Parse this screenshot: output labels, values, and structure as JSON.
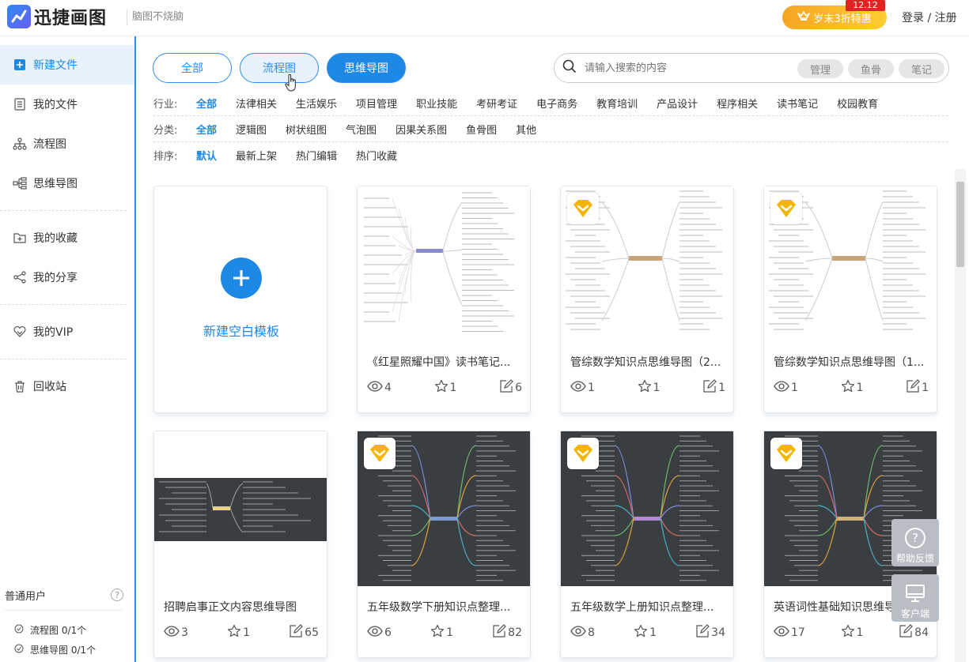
{
  "app": {
    "name": "迅捷画图",
    "slogan": "脑图不烧脑"
  },
  "promo": {
    "label": "岁末3折特惠",
    "tag": "12.12"
  },
  "auth": {
    "label": "登录 / 注册"
  },
  "sidebar": {
    "items": [
      {
        "label": "新建文件",
        "icon": "plus-square-icon",
        "active": true
      },
      {
        "label": "我的文件",
        "icon": "document-icon"
      },
      {
        "label": "流程图",
        "icon": "flowchart-icon"
      },
      {
        "label": "思维导图",
        "icon": "mindmap-icon"
      },
      {
        "label": "我的收藏",
        "icon": "folder-plus-icon"
      },
      {
        "label": "我的分享",
        "icon": "share-icon"
      },
      {
        "label": "我的VIP",
        "icon": "vip-heart-icon"
      },
      {
        "label": "回收站",
        "icon": "trash-icon"
      }
    ],
    "user_type": "普通用户",
    "quotas": [
      {
        "label": "流程图 0/1个"
      },
      {
        "label": "思维导图 0/1个"
      }
    ]
  },
  "tabs": [
    "全部",
    "流程图",
    "思维导图"
  ],
  "search": {
    "placeholder": "请输入搜索的内容",
    "chips": [
      "管理",
      "鱼骨",
      "笔记"
    ]
  },
  "filters": {
    "industry": {
      "label": "行业:",
      "options": [
        "全部",
        "法律相关",
        "生活娱乐",
        "项目管理",
        "职业技能",
        "考研考证",
        "电子商务",
        "教育培训",
        "产品设计",
        "程序相关",
        "读书笔记",
        "校园教育"
      ]
    },
    "category": {
      "label": "分类:",
      "options": [
        "全部",
        "逻辑图",
        "树状组图",
        "气泡图",
        "因果关系图",
        "鱼骨图",
        "其他"
      ]
    },
    "sort": {
      "label": "排序:",
      "options": [
        "默认",
        "最新上架",
        "热门编辑",
        "热门收藏"
      ]
    }
  },
  "new_card": {
    "label": "新建空白模板"
  },
  "cards": [
    {
      "title": "《红星照耀中国》读书笔记...",
      "views": "4",
      "stars": "1",
      "edits": "6",
      "vip": false,
      "theme": "light"
    },
    {
      "title": "管综数学知识点思维导图（2...",
      "views": "1",
      "stars": "1",
      "edits": "1",
      "vip": true,
      "theme": "light"
    },
    {
      "title": "管综数学知识点思维导图（1...",
      "views": "1",
      "stars": "1",
      "edits": "1",
      "vip": true,
      "theme": "light"
    },
    {
      "title": "招聘启事正文内容思维导图",
      "views": "3",
      "stars": "1",
      "edits": "65",
      "vip": false,
      "theme": "band"
    },
    {
      "title": "五年级数学下册知识点整理...",
      "views": "6",
      "stars": "1",
      "edits": "82",
      "vip": true,
      "theme": "dark"
    },
    {
      "title": "五年级数学上册知识点整理...",
      "views": "8",
      "stars": "1",
      "edits": "34",
      "vip": true,
      "theme": "dark"
    },
    {
      "title": "英语词性基础知识思维导图",
      "views": "17",
      "stars": "1",
      "edits": "84",
      "vip": true,
      "theme": "dark"
    }
  ],
  "float_buttons": [
    {
      "label": "帮助反馈"
    },
    {
      "label": "客户端"
    }
  ],
  "colors": {
    "accent": "#1e88e5",
    "vip": "#f5b400",
    "promo": "#f5a623"
  }
}
